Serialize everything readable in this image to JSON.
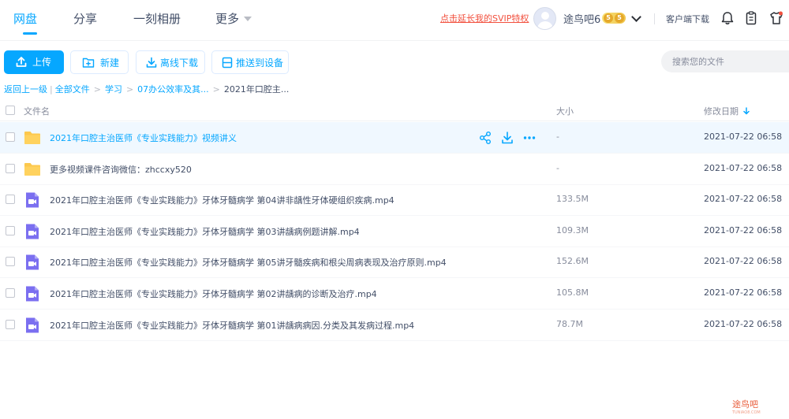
{
  "nav": {
    "tabs": [
      {
        "label": "网盘",
        "active": true
      },
      {
        "label": "分享"
      },
      {
        "label": "一刻相册"
      },
      {
        "label": "更多"
      }
    ],
    "svip_promo": "点击延长我的SVIP特权",
    "username": "途鸟吧6",
    "vip_badge": [
      "5",
      "5"
    ],
    "client_download": "客户端下载"
  },
  "toolbar": {
    "upload": "上传",
    "new_folder": "新建",
    "offline_download": "离线下载",
    "push_device": "推送到设备",
    "search_placeholder": "搜索您的文件"
  },
  "breadcrumb": {
    "back": "返回上一级",
    "all": "全部文件",
    "items": [
      "学习",
      "07办公效率及其...",
      "2021年口腔主..."
    ]
  },
  "table": {
    "headers": {
      "name": "文件名",
      "size": "大小",
      "modified": "修改日期"
    },
    "rows": [
      {
        "type": "folder",
        "name": "2021年口腔主治医师《专业实践能力》视频讲义",
        "size": "-",
        "date": "2021-07-22 06:58",
        "highlighted": true
      },
      {
        "type": "folder",
        "name": "更多视频课件咨询微信：zhccxy520",
        "size": "-",
        "date": "2021-07-22 06:58"
      },
      {
        "type": "video",
        "name": "2021年口腔主治医师《专业实践能力》牙体牙髓病学 第04讲非龋性牙体硬组织疾病.mp4",
        "size": "133.5M",
        "date": "2021-07-22 06:58"
      },
      {
        "type": "video",
        "name": "2021年口腔主治医师《专业实践能力》牙体牙髓病学 第03讲龋病例题讲解.mp4",
        "size": "109.3M",
        "date": "2021-07-22 06:58"
      },
      {
        "type": "video",
        "name": "2021年口腔主治医师《专业实践能力》牙体牙髓病学 第05讲牙髓疾病和根尖周病表现及治疗原则.mp4",
        "size": "152.6M",
        "date": "2021-07-22 06:58"
      },
      {
        "type": "video",
        "name": "2021年口腔主治医师《专业实践能力》牙体牙髓病学 第02讲龋病的诊断及治疗.mp4",
        "size": "105.8M",
        "date": "2021-07-22 06:58"
      },
      {
        "type": "video",
        "name": "2021年口腔主治医师《专业实践能力》牙体牙髓病学 第01讲龋病病因.分类及其发病过程.mp4",
        "size": "78.7M",
        "date": "2021-07-22 06:58"
      }
    ]
  },
  "watermark": {
    "text": "途鸟吧",
    "sub": "TUNIAO8.COM"
  },
  "colors": {
    "accent": "#06a7ff",
    "promo": "#f2503e",
    "folder": "#fcc84d",
    "video": "#7b6ff0"
  }
}
